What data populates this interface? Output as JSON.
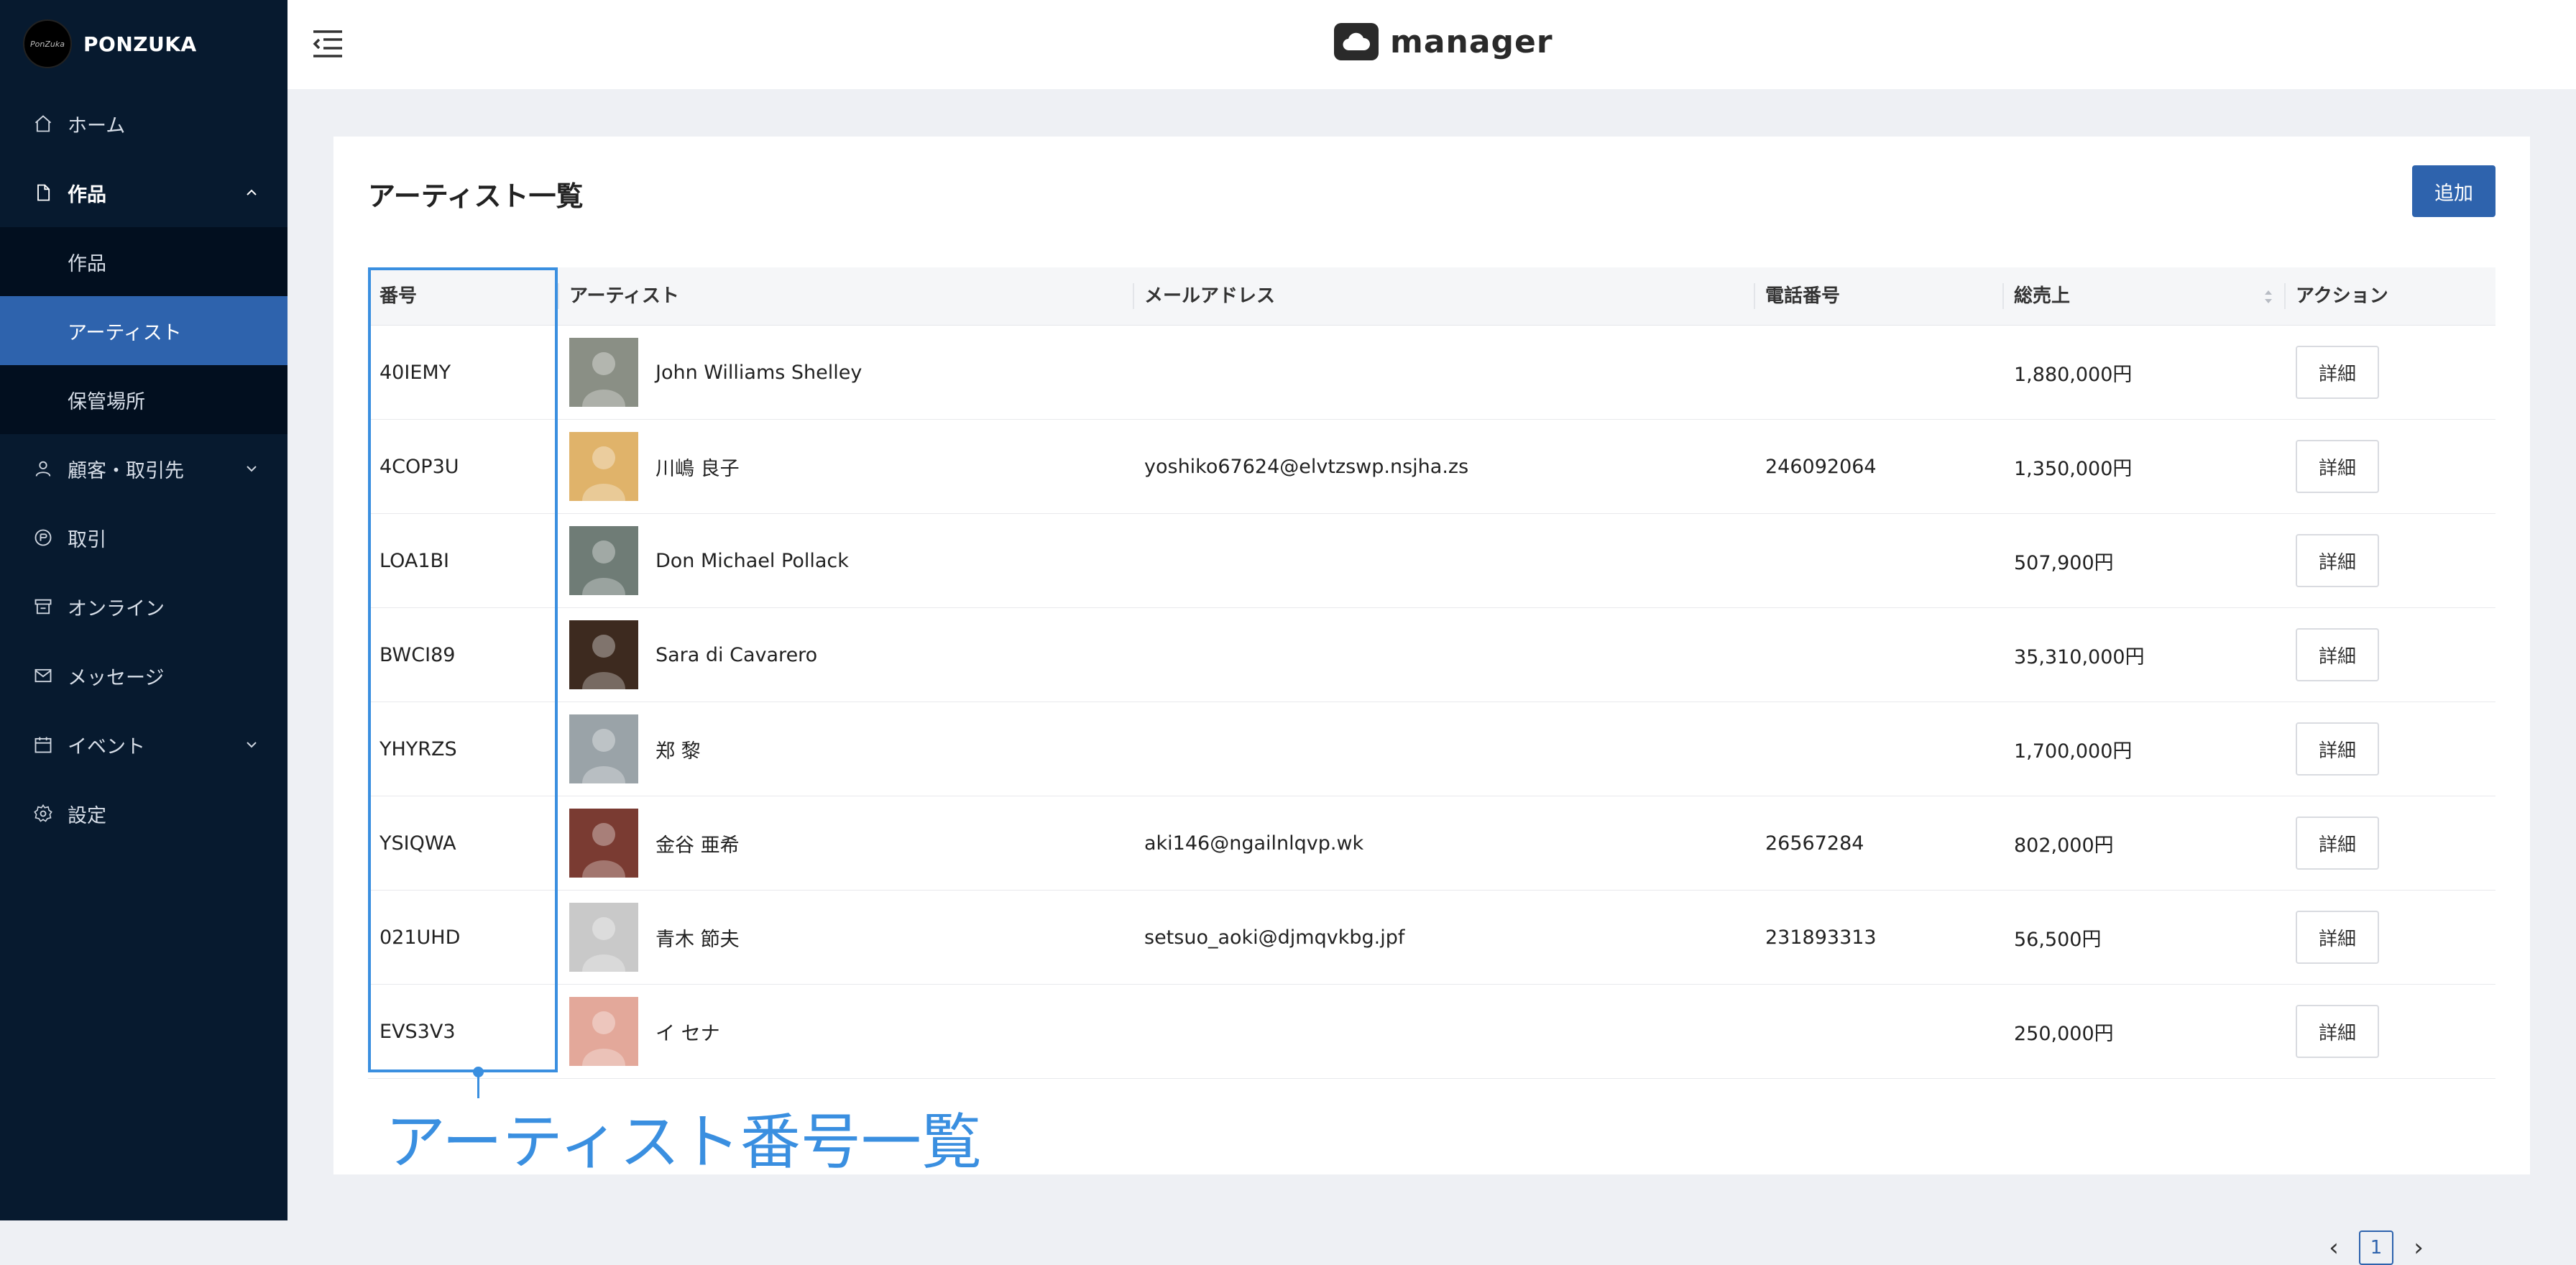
{
  "sidebar": {
    "brand": "PONZUKA",
    "logo_mark": "PonZuka",
    "items": [
      {
        "label": "ホーム",
        "icon": "home-icon"
      },
      {
        "label": "作品",
        "icon": "file-icon",
        "expanded": true
      },
      {
        "label": "作品",
        "sub": true
      },
      {
        "label": "アーティスト",
        "sub": true,
        "active": true
      },
      {
        "label": "保管場所",
        "sub": true
      },
      {
        "label": "顧客・取引先",
        "icon": "user-icon"
      },
      {
        "label": "取引",
        "icon": "transaction-icon"
      },
      {
        "label": "オンライン",
        "icon": "shop-icon"
      },
      {
        "label": "メッセージ",
        "icon": "mail-icon"
      },
      {
        "label": "イベント",
        "icon": "calendar-icon"
      },
      {
        "label": "設定",
        "icon": "gear-icon"
      }
    ]
  },
  "header": {
    "logo_text": "manager"
  },
  "page": {
    "title": "アーティスト一覧",
    "add_label": "追加"
  },
  "table": {
    "columns": [
      "番号",
      "アーティスト",
      "メールアドレス",
      "電話番号",
      "総売上",
      "アクション"
    ],
    "rows": [
      {
        "id": "40IEMY",
        "artist": "John Williams Shelley",
        "email": "",
        "phone": "",
        "sales": "1,880,000円",
        "action": "詳細",
        "avatar_color": "#8a8f85"
      },
      {
        "id": "4COP3U",
        "artist": "川嶋 良子",
        "email": "yoshiko67624@elvtzswp.nsjha.zs",
        "phone": "246092064",
        "sales": "1,350,000円",
        "action": "詳細",
        "avatar_color": "#e0b36a"
      },
      {
        "id": "LOA1BI",
        "artist": "Don Michael Pollack",
        "email": "",
        "phone": "",
        "sales": "507,900円",
        "action": "詳細",
        "avatar_color": "#6f7c76"
      },
      {
        "id": "BWCI89",
        "artist": "Sara di Cavarero",
        "email": "",
        "phone": "",
        "sales": "35,310,000円",
        "action": "詳細",
        "avatar_color": "#3d2a1f"
      },
      {
        "id": "YHYRZS",
        "artist": "郑 黎",
        "email": "",
        "phone": "",
        "sales": "1,700,000円",
        "action": "詳細",
        "avatar_color": "#9aa3a8"
      },
      {
        "id": "YSIQWA",
        "artist": "金谷 亜希",
        "email": "aki146@ngailnlqvp.wk",
        "phone": "26567284",
        "sales": "802,000円",
        "action": "詳細",
        "avatar_color": "#7a3b32"
      },
      {
        "id": "021UHD",
        "artist": "青木 節夫",
        "email": "setsuo_aoki@djmqvkbg.jpf",
        "phone": "231893313",
        "sales": "56,500円",
        "action": "詳細",
        "avatar_color": "#c9c9c9"
      },
      {
        "id": "EVS3V3",
        "artist": "イ セナ",
        "email": "",
        "phone": "",
        "sales": "250,000円",
        "action": "詳細",
        "avatar_color": "#e3a89a"
      }
    ]
  },
  "annotation": {
    "label": "アーティスト番号一覧"
  },
  "pagination": {
    "current": "1",
    "prev": "‹",
    "next": "›"
  }
}
